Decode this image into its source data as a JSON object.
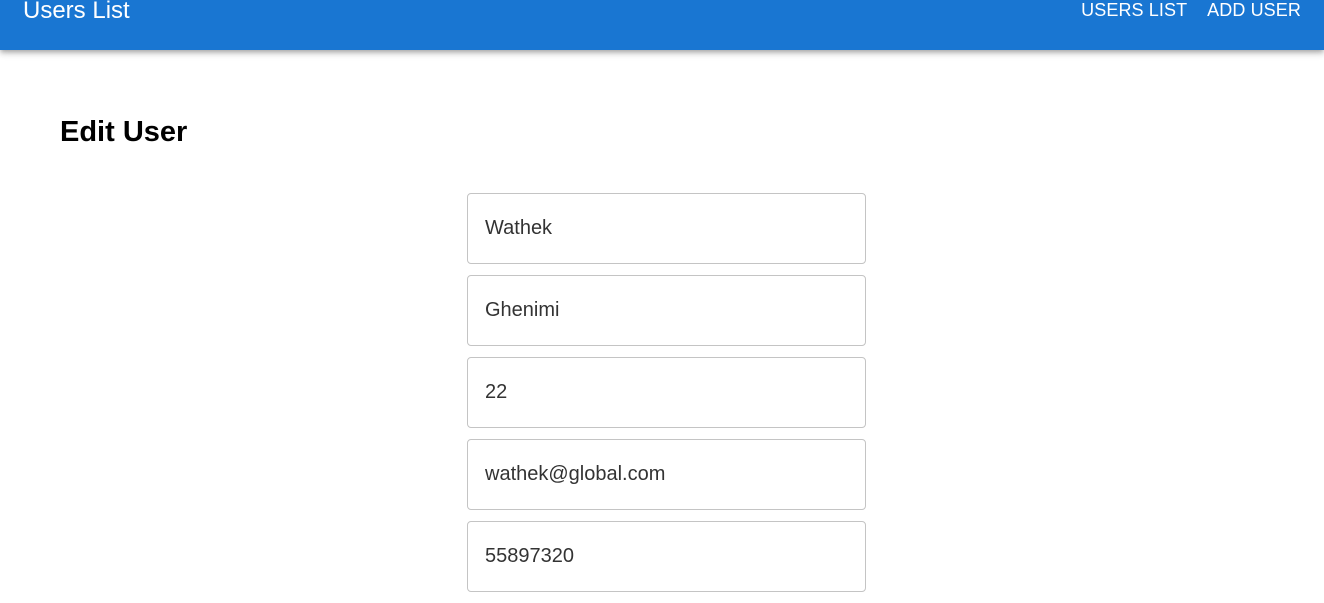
{
  "appbar": {
    "title": "Users List",
    "nav": {
      "users_list": "USERS LIST",
      "add_user": "ADD USER"
    },
    "color": "#1976d2"
  },
  "page": {
    "title": "Edit User"
  },
  "form": {
    "first_name": "Wathek",
    "last_name": "Ghenimi",
    "age": "22",
    "email": "wathek@global.com",
    "phone": "55897320"
  }
}
